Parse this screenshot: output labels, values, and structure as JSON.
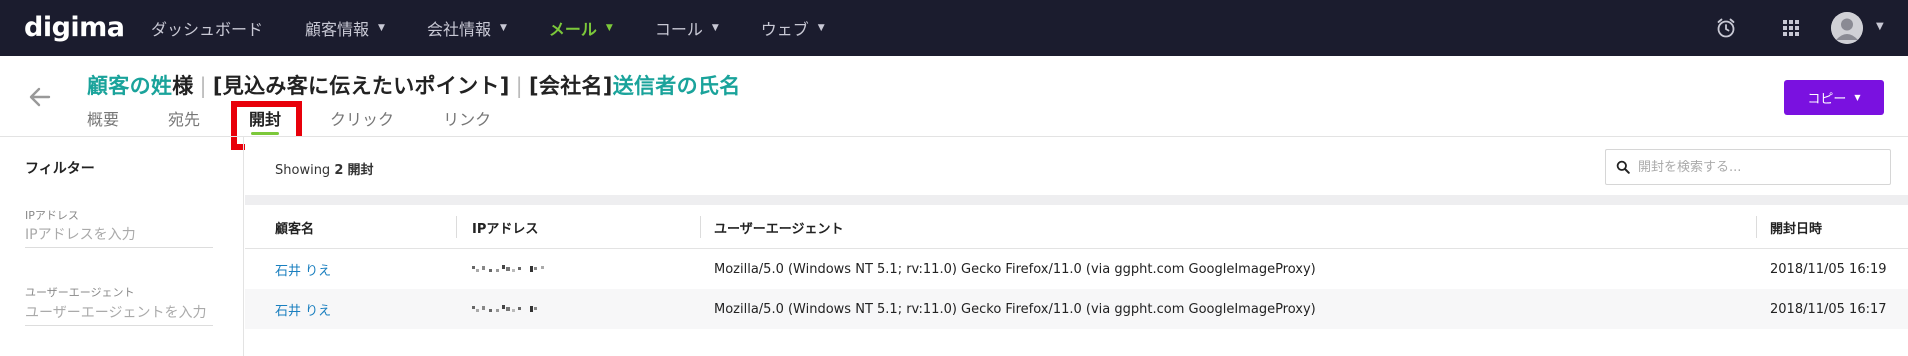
{
  "nav": {
    "logo": "digima",
    "items": [
      {
        "label": "ダッシュボード",
        "caret": false,
        "active": false
      },
      {
        "label": "顧客情報",
        "caret": true,
        "active": false
      },
      {
        "label": "会社情報",
        "caret": true,
        "active": false
      },
      {
        "label": "メール",
        "caret": true,
        "active": true
      },
      {
        "label": "コール",
        "caret": true,
        "active": false
      },
      {
        "label": "ウェブ",
        "caret": true,
        "active": false
      }
    ],
    "icons": [
      "alarm-icon",
      "apps-grid-icon",
      "user-avatar-icon"
    ]
  },
  "header": {
    "title_parts": [
      {
        "text": "顧客の姓",
        "var": true
      },
      {
        "text": "様",
        "var": false
      },
      {
        "text": "|",
        "sep": true
      },
      {
        "text": "[見込み客に伝えたいポイント]",
        "var": false
      },
      {
        "text": "|",
        "sep": true
      },
      {
        "text": "[会社名]",
        "var": false
      },
      {
        "text": "送信者の氏名",
        "var": true
      }
    ],
    "tabs": [
      {
        "label": "概要",
        "active": false
      },
      {
        "label": "宛先",
        "active": false
      },
      {
        "label": "開封",
        "active": true
      },
      {
        "label": "クリック",
        "active": false
      },
      {
        "label": "リンク",
        "active": false
      }
    ],
    "copy_button": "コピー"
  },
  "sidebar": {
    "title": "フィルター",
    "filters": [
      {
        "label": "IPアドレス",
        "placeholder": "IPアドレスを入力"
      },
      {
        "label": "ユーザーエージェント",
        "placeholder": "ユーザーエージェントを入力"
      }
    ]
  },
  "main": {
    "showing_prefix": "Showing",
    "showing_count": "2",
    "showing_suffix": "開封",
    "search_placeholder": "開封を検索する...",
    "columns": [
      "顧客名",
      "IPアドレス",
      "ユーザーエージェント",
      "開封日時"
    ],
    "rows": [
      {
        "name": "石井 りえ",
        "ip": "",
        "user_agent": "Mozilla/5.0 (Windows NT 5.1; rv:11.0) Gecko Firefox/11.0 (via ggpht.com GoogleImageProxy)",
        "opened_at": "2018/11/05 16:19"
      },
      {
        "name": "石井 りえ",
        "ip": "",
        "user_agent": "Mozilla/5.0 (Windows NT 5.1; rv:11.0) Gecko Firefox/11.0 (via ggpht.com GoogleImageProxy)",
        "opened_at": "2018/11/05 16:17"
      }
    ]
  },
  "colors": {
    "nav_bg": "#1b1c2e",
    "accent_green": "#7cc83a",
    "variable_teal": "#1aa39b",
    "copy_purple": "#7a11e0",
    "highlight_red": "#e8000a",
    "link_blue": "#1a7fbf"
  }
}
